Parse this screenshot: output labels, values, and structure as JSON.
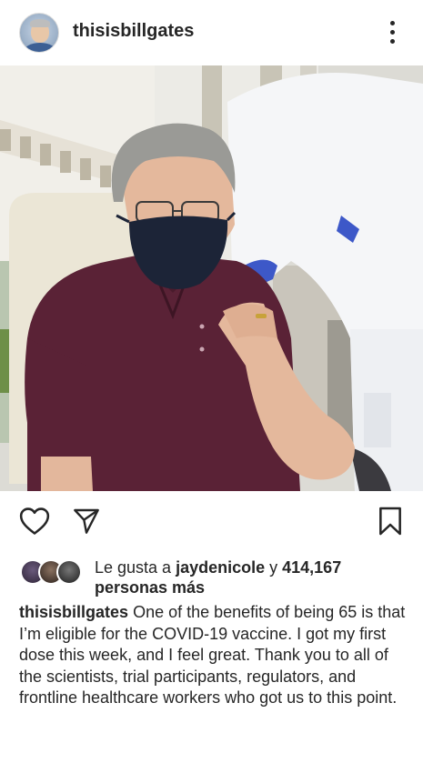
{
  "post": {
    "username": "thisisbillgates",
    "photo_description": "Bill Gates wearing a mask receiving a COVID-19 vaccine"
  },
  "likes": {
    "prefix": "Le gusta a ",
    "user": "jaydenicole",
    "middle": " y ",
    "count": "414,167",
    "suffix": "personas más"
  },
  "caption": {
    "username": "thisisbillgates",
    "text": "One of the benefits of being 65 is that I’m eligible for the COVID-19 vaccine. I got my first dose this week, and I feel great. Thank you to all of the scientists, trial participants, regulators, and frontline healthcare workers who got us to this point."
  },
  "icons": {
    "more": "more-options-icon",
    "like": "heart-icon",
    "share": "paper-plane-icon",
    "save": "bookmark-icon"
  },
  "colors": {
    "text": "#262626",
    "shirt": "#5a2236",
    "mask": "#1c2437"
  }
}
